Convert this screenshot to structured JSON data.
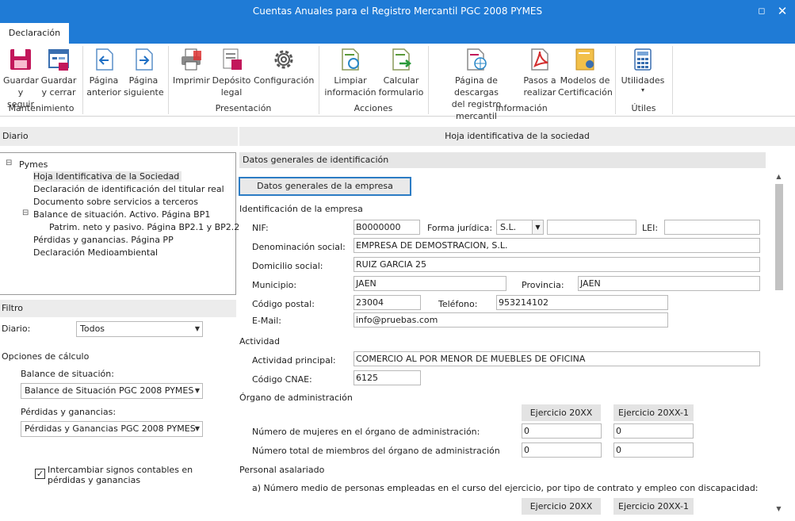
{
  "window": {
    "title": "Cuentas Anuales para el Registro Mercantil PGC 2008 PYMES",
    "maximize_glyph": "◻",
    "close_glyph": "✕"
  },
  "ribbon": {
    "tab": "Declaración",
    "buttons": {
      "guardar_seguir": [
        "Guardar",
        "y seguir"
      ],
      "guardar_cerrar": [
        "Guardar",
        "y cerrar"
      ],
      "pagina_anterior": [
        "Página",
        "anterior"
      ],
      "pagina_siguiente": [
        "Página",
        "siguiente"
      ],
      "imprimir": [
        "Imprimir"
      ],
      "deposito_legal": [
        "Depósito",
        "legal"
      ],
      "configuracion": [
        "Configuración"
      ],
      "limpiar": [
        "Limpiar",
        "información"
      ],
      "calcular": [
        "Calcular",
        "formulario"
      ],
      "descargas": [
        "Página de descargas",
        "del registro mercantil"
      ],
      "pasos": [
        "Pasos a",
        "realizar"
      ],
      "modelos": [
        "Modelos de",
        "Certificación"
      ],
      "utilidades": [
        "Utilidades",
        "▾"
      ]
    },
    "groups": {
      "mantenimiento": "Mantenimiento",
      "presentacion": "Presentación",
      "acciones": "Acciones",
      "informacion": "Información",
      "utiles": "Útiles"
    }
  },
  "left": {
    "header": "Diario",
    "tree": {
      "expander": "⊟",
      "root": "Pymes",
      "items": [
        "Hoja Identificativa de la Sociedad",
        "Declaración de identificación del titular real",
        "Documento sobre servicios a terceros",
        "Balance de situación. Activo. Página BP1",
        "Patrim. neto y pasivo. Página BP2.1 y BP2.2",
        "Pérdidas y ganancias. Página PP",
        "Declaración Medioambiental"
      ],
      "subexpander": "⊟"
    },
    "filtro": {
      "header": "Filtro",
      "diario_label": "Diario:",
      "diario_value": "Todos",
      "opciones": "Opciones de cálculo",
      "balance_label": "Balance de situación:",
      "balance_value": "Balance de Situación PGC 2008 PYMES",
      "perdidas_label": "Pérdidas y ganancias:",
      "perdidas_value": "Pérdidas y Ganancias PGC 2008 PYMES",
      "checkbox_label_1": "Intercambiar signos contables en",
      "checkbox_label_2": "pérdidas y ganancias",
      "checkbox_mark": "✓"
    }
  },
  "form": {
    "header": "Hoja identificativa de la sociedad",
    "section": "Datos generales de identificación",
    "company_button": "Datos generales de la empresa",
    "ident_title": "Identificación de la empresa",
    "nif_label": "NIF:",
    "nif": "B0000000",
    "forma_label": "Forma jurídica:",
    "forma": "S.L.",
    "forma_extra": "",
    "lei_label": "LEI:",
    "lei": "",
    "denom_label": "Denominación social:",
    "denom": "EMPRESA DE DEMOSTRACION, S.L.",
    "domicilio_label": "Domicilio social:",
    "domicilio": "RUIZ GARCIA 25",
    "municipio_label": "Municipio:",
    "municipio": "JAEN",
    "provincia_label": "Provincia:",
    "provincia": "JAEN",
    "cp_label": "Código postal:",
    "cp": "23004",
    "tel_label": "Teléfono:",
    "tel": "953214102",
    "email_label": "E-Mail:",
    "email": "info@pruebas.com",
    "actividad_title": "Actividad",
    "act_label": "Actividad principal:",
    "act": "COMERCIO AL POR MENOR DE MUEBLES DE OFICINA",
    "cnae_label": "Código CNAE:",
    "cnae": "6125",
    "organo_title": "Órgano de administración",
    "col1": "Ejercicio 20XX",
    "col2": "Ejercicio 20XX-1",
    "mujeres_label": "Número de mujeres en el órgano de administración:",
    "mujeres_1": "0",
    "mujeres_2": "0",
    "total_label": "Número total de miembros del órgano de administración",
    "total_1": "0",
    "total_2": "0",
    "personal_title": "Personal asalariado",
    "personal_a": "a) Número medio de personas empleadas en el curso del ejercicio, por tipo de contrato y empleo con discapacidad:",
    "col1b": "Ejercicio 20XX",
    "col2b": "Ejercicio 20XX-1"
  },
  "colors": {
    "accent": "#1f7bd6",
    "focus_border": "#2c7cc4"
  }
}
